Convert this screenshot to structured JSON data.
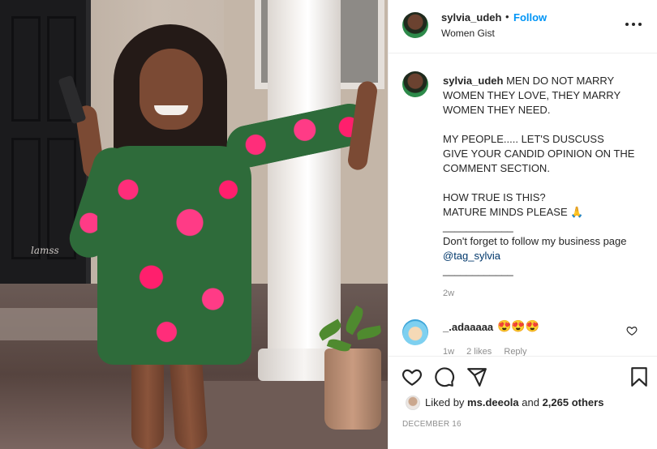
{
  "photo": {
    "watermark": "lamss"
  },
  "header": {
    "username": "sylvia_udeh",
    "separator": "•",
    "follow_label": "Follow",
    "subtitle": "Women Gist"
  },
  "caption": {
    "username": "sylvia_udeh",
    "lines": [
      "MEN DO NOT MARRY WOMEN THEY LOVE, THEY MARRY WOMEN THEY NEED.",
      "MY PEOPLE..... LET'S DUSCUSS",
      "GIVE YOUR CANDID OPINION ON THE COMMENT SECTION.",
      "HOW TRUE IS THIS?",
      "MATURE MINDS PLEASE 🙏",
      "____________",
      "Don't forget to follow my business page ",
      "@tag_sylvia",
      "____________"
    ],
    "time_ago": "2w"
  },
  "comment": {
    "username": "_.adaaaaa",
    "text": "😍😍😍",
    "time": "1w",
    "likes": "2 likes",
    "reply_label": "Reply"
  },
  "actions": {
    "liked_by_prefix": "Liked by ",
    "liked_by_user": "ms.deeola",
    "and_text": " and ",
    "others": "2,265 others",
    "date": "DECEMBER 16"
  },
  "colors": {
    "link_blue": "#0095f6",
    "mention_blue": "#00376b",
    "muted_gray": "#8e8e8e",
    "text": "#262626"
  },
  "icons": [
    "more-options-icon",
    "heart-icon",
    "comment-icon",
    "share-icon",
    "bookmark-icon",
    "comment-like-heart-icon",
    "prayer-hands-emoji"
  ]
}
